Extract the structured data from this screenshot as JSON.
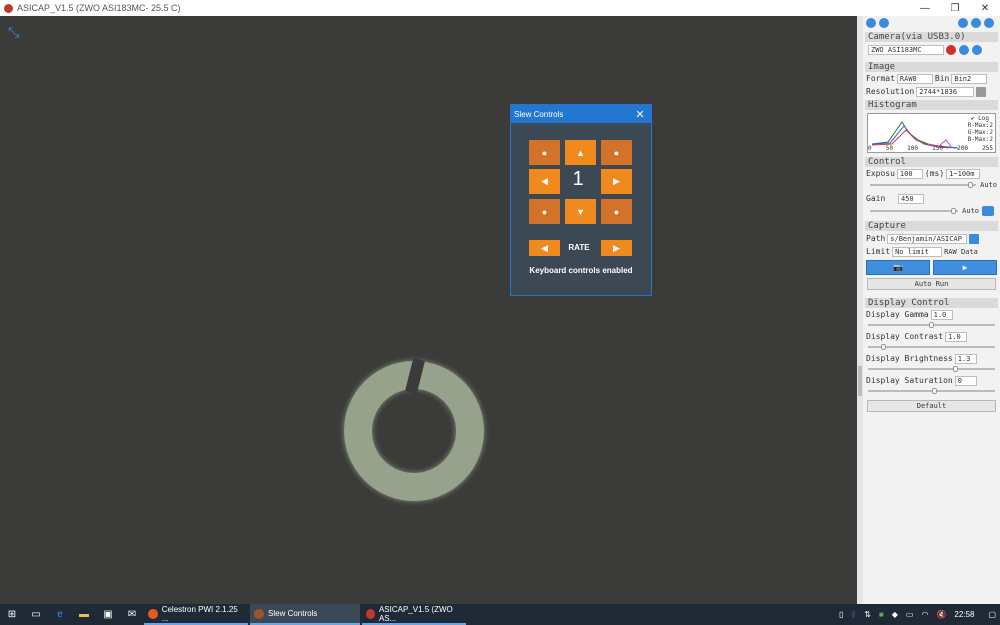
{
  "window": {
    "title": "ASICAP_V1.5 (ZWO ASI183MC- 25.5 C)"
  },
  "slew_dialog": {
    "title": "Slew Controls",
    "rate_value": "1",
    "rate_label": "RATE",
    "status": "Keyboard controls enabled"
  },
  "panel": {
    "camera_section": "Camera(via USB3.0)",
    "camera_name": "ZWO ASI183MC",
    "image_section": "Image",
    "format_label": "Format",
    "format_value": "RAW8",
    "bin_label": "Bin",
    "bin_value": "Bin2",
    "resolution_label": "Resolution",
    "resolution_value": "2744*1836",
    "histogram_section": "Histogram",
    "hist_log": "Log",
    "hist_r": "R-Max:2",
    "hist_g": "G-Max:2",
    "hist_b": "B-Max:2",
    "hist_ticks": [
      "0",
      "50",
      "100",
      "150",
      "200",
      "255"
    ],
    "control_section": "Control",
    "exposure_label": "Exposu",
    "exposure_value": "100",
    "exposure_unit": "(ms)",
    "exposure_range": "1~100m",
    "exposure_auto": "Auto",
    "gain_label": "Gain",
    "gain_value": "450",
    "gain_auto": "Auto",
    "capture_section": "Capture",
    "path_label": "Path",
    "path_value": "s/Benjamin/ASICAP",
    "limit_label": "Limit",
    "limit_value": "No limit",
    "raw_data": "RAW Data",
    "auto_run": "Auto Run",
    "display_section": "Display Control",
    "gamma_label": "Display Gamma",
    "gamma_value": "1.0",
    "contrast_label": "Display Contrast",
    "contrast_value": "1.0",
    "brightness_label": "Display Brightness",
    "brightness_value": "1.3",
    "saturation_label": "Display Saturation",
    "saturation_value": "0",
    "default_button": "Default"
  },
  "taskbar": {
    "apps": [
      "Celestron PWI 2.1.25 ...",
      "Slew Controls",
      "ASICAP_V1.5 (ZWO AS..."
    ],
    "clock": "22:58"
  }
}
